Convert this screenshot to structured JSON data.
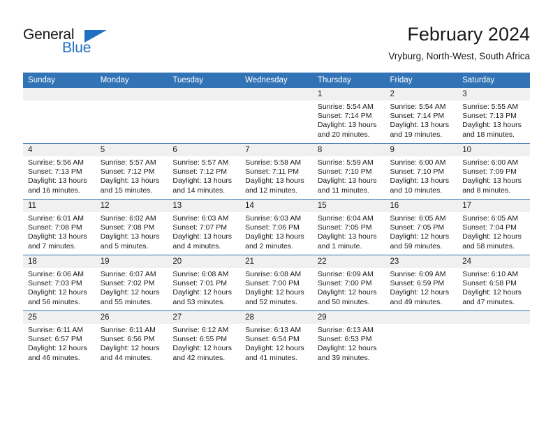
{
  "brand": {
    "name_part1": "General",
    "name_part2": "Blue",
    "flag_icon": "blue-triangle-flag-icon"
  },
  "header": {
    "month_title": "February 2024",
    "location": "Vryburg, North-West, South Africa"
  },
  "theme": {
    "header_blue": "#3273b5",
    "daynum_band_gray": "#f0f0f0",
    "text_black": "#1a1a1a",
    "brand_blue": "#1f70c1"
  },
  "weekday_headers": [
    "Sunday",
    "Monday",
    "Tuesday",
    "Wednesday",
    "Thursday",
    "Friday",
    "Saturday"
  ],
  "weeks": [
    [
      {
        "empty": true
      },
      {
        "empty": true
      },
      {
        "empty": true
      },
      {
        "empty": true
      },
      {
        "day": "1",
        "sunrise": "Sunrise: 5:54 AM",
        "sunset": "Sunset: 7:14 PM",
        "daylight_line1": "Daylight: 13 hours",
        "daylight_line2": "and 20 minutes."
      },
      {
        "day": "2",
        "sunrise": "Sunrise: 5:54 AM",
        "sunset": "Sunset: 7:14 PM",
        "daylight_line1": "Daylight: 13 hours",
        "daylight_line2": "and 19 minutes."
      },
      {
        "day": "3",
        "sunrise": "Sunrise: 5:55 AM",
        "sunset": "Sunset: 7:13 PM",
        "daylight_line1": "Daylight: 13 hours",
        "daylight_line2": "and 18 minutes."
      }
    ],
    [
      {
        "day": "4",
        "sunrise": "Sunrise: 5:56 AM",
        "sunset": "Sunset: 7:13 PM",
        "daylight_line1": "Daylight: 13 hours",
        "daylight_line2": "and 16 minutes."
      },
      {
        "day": "5",
        "sunrise": "Sunrise: 5:57 AM",
        "sunset": "Sunset: 7:12 PM",
        "daylight_line1": "Daylight: 13 hours",
        "daylight_line2": "and 15 minutes."
      },
      {
        "day": "6",
        "sunrise": "Sunrise: 5:57 AM",
        "sunset": "Sunset: 7:12 PM",
        "daylight_line1": "Daylight: 13 hours",
        "daylight_line2": "and 14 minutes."
      },
      {
        "day": "7",
        "sunrise": "Sunrise: 5:58 AM",
        "sunset": "Sunset: 7:11 PM",
        "daylight_line1": "Daylight: 13 hours",
        "daylight_line2": "and 12 minutes."
      },
      {
        "day": "8",
        "sunrise": "Sunrise: 5:59 AM",
        "sunset": "Sunset: 7:10 PM",
        "daylight_line1": "Daylight: 13 hours",
        "daylight_line2": "and 11 minutes."
      },
      {
        "day": "9",
        "sunrise": "Sunrise: 6:00 AM",
        "sunset": "Sunset: 7:10 PM",
        "daylight_line1": "Daylight: 13 hours",
        "daylight_line2": "and 10 minutes."
      },
      {
        "day": "10",
        "sunrise": "Sunrise: 6:00 AM",
        "sunset": "Sunset: 7:09 PM",
        "daylight_line1": "Daylight: 13 hours",
        "daylight_line2": "and 8 minutes."
      }
    ],
    [
      {
        "day": "11",
        "sunrise": "Sunrise: 6:01 AM",
        "sunset": "Sunset: 7:08 PM",
        "daylight_line1": "Daylight: 13 hours",
        "daylight_line2": "and 7 minutes."
      },
      {
        "day": "12",
        "sunrise": "Sunrise: 6:02 AM",
        "sunset": "Sunset: 7:08 PM",
        "daylight_line1": "Daylight: 13 hours",
        "daylight_line2": "and 5 minutes."
      },
      {
        "day": "13",
        "sunrise": "Sunrise: 6:03 AM",
        "sunset": "Sunset: 7:07 PM",
        "daylight_line1": "Daylight: 13 hours",
        "daylight_line2": "and 4 minutes."
      },
      {
        "day": "14",
        "sunrise": "Sunrise: 6:03 AM",
        "sunset": "Sunset: 7:06 PM",
        "daylight_line1": "Daylight: 13 hours",
        "daylight_line2": "and 2 minutes."
      },
      {
        "day": "15",
        "sunrise": "Sunrise: 6:04 AM",
        "sunset": "Sunset: 7:05 PM",
        "daylight_line1": "Daylight: 13 hours",
        "daylight_line2": "and 1 minute."
      },
      {
        "day": "16",
        "sunrise": "Sunrise: 6:05 AM",
        "sunset": "Sunset: 7:05 PM",
        "daylight_line1": "Daylight: 12 hours",
        "daylight_line2": "and 59 minutes."
      },
      {
        "day": "17",
        "sunrise": "Sunrise: 6:05 AM",
        "sunset": "Sunset: 7:04 PM",
        "daylight_line1": "Daylight: 12 hours",
        "daylight_line2": "and 58 minutes."
      }
    ],
    [
      {
        "day": "18",
        "sunrise": "Sunrise: 6:06 AM",
        "sunset": "Sunset: 7:03 PM",
        "daylight_line1": "Daylight: 12 hours",
        "daylight_line2": "and 56 minutes."
      },
      {
        "day": "19",
        "sunrise": "Sunrise: 6:07 AM",
        "sunset": "Sunset: 7:02 PM",
        "daylight_line1": "Daylight: 12 hours",
        "daylight_line2": "and 55 minutes."
      },
      {
        "day": "20",
        "sunrise": "Sunrise: 6:08 AM",
        "sunset": "Sunset: 7:01 PM",
        "daylight_line1": "Daylight: 12 hours",
        "daylight_line2": "and 53 minutes."
      },
      {
        "day": "21",
        "sunrise": "Sunrise: 6:08 AM",
        "sunset": "Sunset: 7:00 PM",
        "daylight_line1": "Daylight: 12 hours",
        "daylight_line2": "and 52 minutes."
      },
      {
        "day": "22",
        "sunrise": "Sunrise: 6:09 AM",
        "sunset": "Sunset: 7:00 PM",
        "daylight_line1": "Daylight: 12 hours",
        "daylight_line2": "and 50 minutes."
      },
      {
        "day": "23",
        "sunrise": "Sunrise: 6:09 AM",
        "sunset": "Sunset: 6:59 PM",
        "daylight_line1": "Daylight: 12 hours",
        "daylight_line2": "and 49 minutes."
      },
      {
        "day": "24",
        "sunrise": "Sunrise: 6:10 AM",
        "sunset": "Sunset: 6:58 PM",
        "daylight_line1": "Daylight: 12 hours",
        "daylight_line2": "and 47 minutes."
      }
    ],
    [
      {
        "day": "25",
        "sunrise": "Sunrise: 6:11 AM",
        "sunset": "Sunset: 6:57 PM",
        "daylight_line1": "Daylight: 12 hours",
        "daylight_line2": "and 46 minutes."
      },
      {
        "day": "26",
        "sunrise": "Sunrise: 6:11 AM",
        "sunset": "Sunset: 6:56 PM",
        "daylight_line1": "Daylight: 12 hours",
        "daylight_line2": "and 44 minutes."
      },
      {
        "day": "27",
        "sunrise": "Sunrise: 6:12 AM",
        "sunset": "Sunset: 6:55 PM",
        "daylight_line1": "Daylight: 12 hours",
        "daylight_line2": "and 42 minutes."
      },
      {
        "day": "28",
        "sunrise": "Sunrise: 6:13 AM",
        "sunset": "Sunset: 6:54 PM",
        "daylight_line1": "Daylight: 12 hours",
        "daylight_line2": "and 41 minutes."
      },
      {
        "day": "29",
        "sunrise": "Sunrise: 6:13 AM",
        "sunset": "Sunset: 6:53 PM",
        "daylight_line1": "Daylight: 12 hours",
        "daylight_line2": "and 39 minutes."
      },
      {
        "empty": true
      },
      {
        "empty": true
      }
    ]
  ]
}
